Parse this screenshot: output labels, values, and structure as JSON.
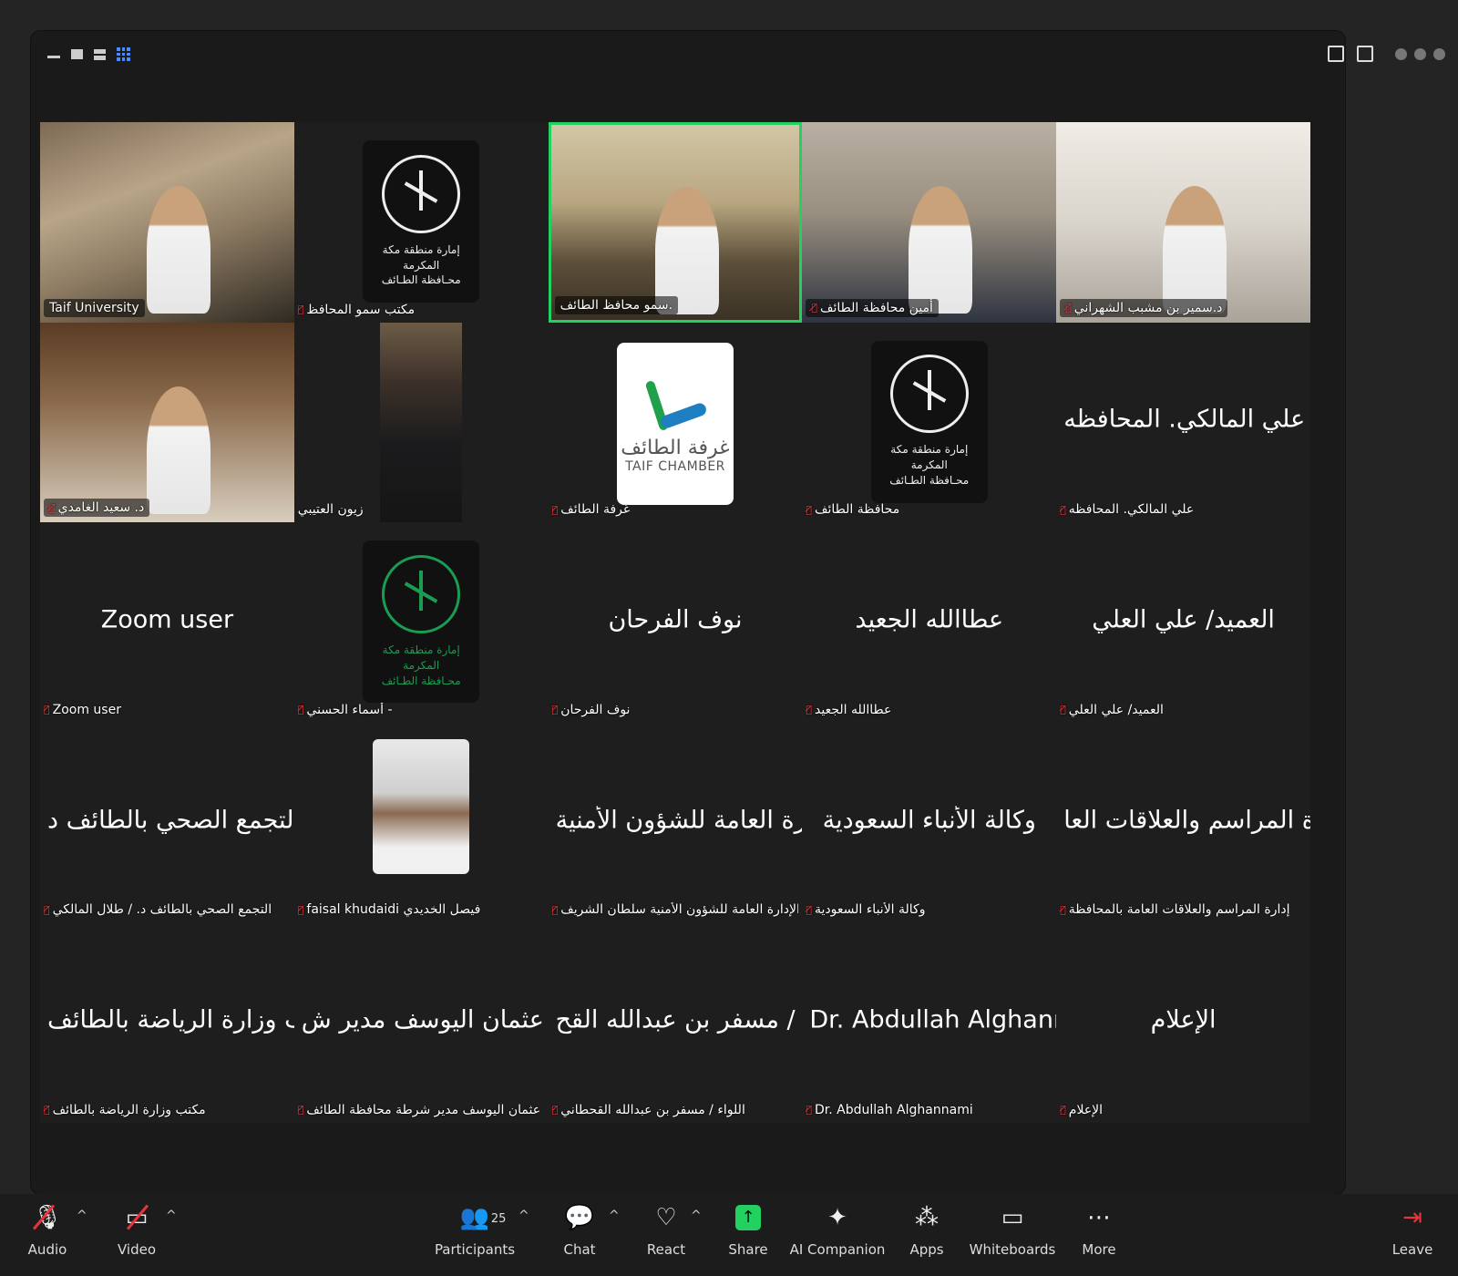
{
  "toolbar": {
    "audio": "Audio",
    "video": "Video",
    "participants": "Participants",
    "participants_count": "25",
    "chat": "Chat",
    "react": "React",
    "share": "Share",
    "ai_companion": "AI Companion",
    "apps": "Apps",
    "whiteboards": "Whiteboards",
    "more": "More",
    "leave": "Leave"
  },
  "tiles": [
    {
      "label": "Taif University",
      "muted": false,
      "kind": "video"
    },
    {
      "label": "مكتب سمو المحافظ",
      "muted": true,
      "kind": "logo",
      "logo_text_1": "إمارة منطقة مكة المكرمة",
      "logo_text_2": "محـافظة الطـائف"
    },
    {
      "label": "سمو محافظ الطائف.",
      "muted": false,
      "kind": "video",
      "active": true
    },
    {
      "label": "أمين محافظة الطائف",
      "muted": true,
      "kind": "video"
    },
    {
      "label": "د.سمير بن مشبب الشهراني",
      "muted": true,
      "kind": "video"
    },
    {
      "label": "د. سعيد الغامدي",
      "muted": true,
      "kind": "video"
    },
    {
      "label": "زيون العتيبي",
      "muted": false,
      "kind": "portrait"
    },
    {
      "label": "غرفة الطائف",
      "muted": true,
      "kind": "chamber",
      "chamber_ar": "غرفة الطائف",
      "chamber_en": "TAIF CHAMBER"
    },
    {
      "label": "محافظة الطائف",
      "muted": true,
      "kind": "logo",
      "logo_text_1": "إمارة منطقة مكة المكرمة",
      "logo_text_2": "محـافظة الطـائف"
    },
    {
      "label": "علي المالكي. المحافظه",
      "muted": true,
      "kind": "name",
      "big": "علي المالكي. المحافظه"
    },
    {
      "label": "Zoom user",
      "muted": true,
      "kind": "name",
      "big": "Zoom user"
    },
    {
      "label": "أسماء الحسني -",
      "muted": true,
      "kind": "logo-green",
      "logo_text_1": "إمارة منطقة مكة المكرمة",
      "logo_text_2": "محـافظة الطـائف"
    },
    {
      "label": "نوف الفرحان",
      "muted": true,
      "kind": "name",
      "big": "نوف الفرحان"
    },
    {
      "label": "عطاالله الجعيد",
      "muted": true,
      "kind": "name",
      "big": "عطاالله الجعيد"
    },
    {
      "label": "العميد/ علي العلي",
      "muted": true,
      "kind": "name",
      "big": "العميد/ علي العلي"
    },
    {
      "label": "التجمع الصحي بالطائف د. / طلال المالكي",
      "muted": true,
      "kind": "name",
      "big": "التجمع الصحي بالطائف د. /..."
    },
    {
      "label": "faisal khudaidi فيصل الخديدي",
      "muted": true,
      "kind": "face"
    },
    {
      "label": "الإدارة العامة للشؤون الأمنية سلطان الشريف",
      "muted": true,
      "kind": "name",
      "big": "الإدارة العامة للشؤون الأمنية..."
    },
    {
      "label": "وكالة الأنباء السعودية",
      "muted": true,
      "kind": "name",
      "big": "وكالة الأنباء السعودية"
    },
    {
      "label": "إدارة المراسم والعلاقات العامة بالمحافظة",
      "muted": true,
      "kind": "name",
      "big": "إدارة المراسم والعلاقات العا..."
    },
    {
      "label": "مكتب وزارة الرياضة بالطائف",
      "muted": true,
      "kind": "name",
      "big": "مكتب وزارة الرياضة بالطائف"
    },
    {
      "label": "اللواء عثمان اليوسف مدير شرطة محافظة الطائف",
      "muted": true,
      "kind": "name",
      "big": "اللواء عثمان اليوسف مدير ش..."
    },
    {
      "label": "اللواء / مسفر بن عبدالله القحطاني",
      "muted": true,
      "kind": "name",
      "big": "اللواء / مسفر بن عبدالله القح..."
    },
    {
      "label": "Dr. Abdullah Alghannami",
      "muted": true,
      "kind": "name",
      "big": "Dr. Abdullah Alghannami"
    },
    {
      "label": "الإعلام",
      "muted": true,
      "kind": "name",
      "big": "الإعلام"
    }
  ]
}
